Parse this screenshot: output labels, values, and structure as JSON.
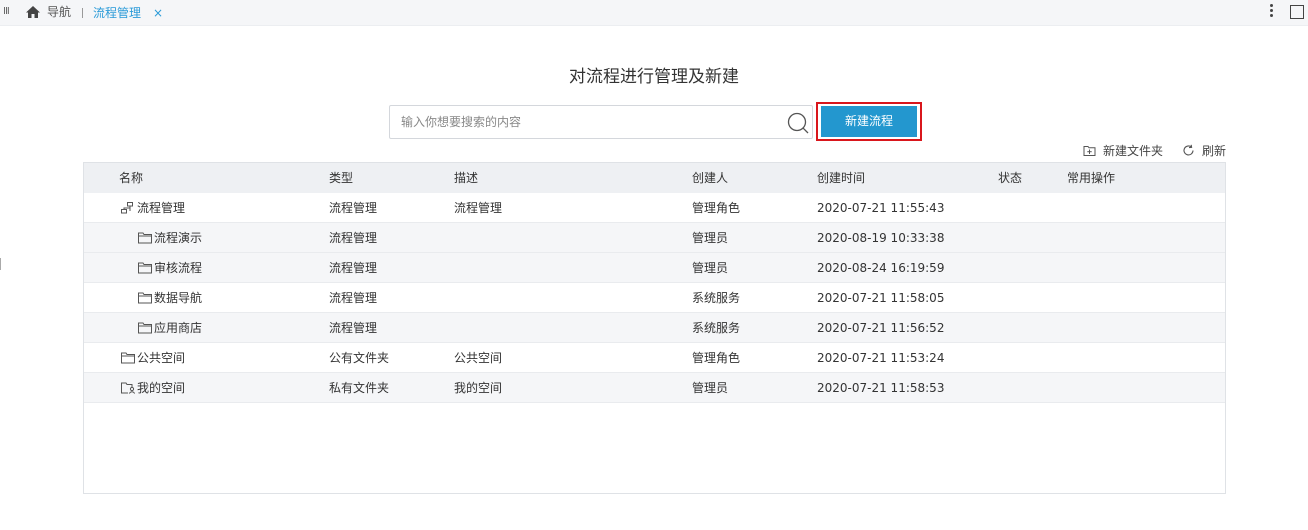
{
  "tabbar": {
    "grip_glyph": "III",
    "home_label": "导航",
    "active_tab_label": "流程管理",
    "close_glyph": "×"
  },
  "page": {
    "title": "对流程进行管理及新建"
  },
  "search": {
    "placeholder": "输入你想要搜索的内容",
    "value": ""
  },
  "actions": {
    "new_flow_label": "新建流程",
    "new_folder_label": "新建文件夹",
    "refresh_label": "刷新"
  },
  "table": {
    "columns": [
      "名称",
      "类型",
      "描述",
      "创建人",
      "创建时间",
      "状态",
      "常用操作"
    ],
    "rows": [
      {
        "icon": "flow-tree-icon",
        "name": "流程管理",
        "type": "流程管理",
        "desc": "流程管理",
        "creator": "管理角色",
        "created": "2020-07-21 11:55:43",
        "status": "",
        "ops": ""
      },
      {
        "icon": "folder-icon",
        "name": "流程演示",
        "type": "流程管理",
        "desc": "",
        "creator": "管理员",
        "created": "2020-08-19 10:33:38",
        "status": "",
        "ops": ""
      },
      {
        "icon": "folder-icon",
        "name": "审核流程",
        "type": "流程管理",
        "desc": "",
        "creator": "管理员",
        "created": "2020-08-24 16:19:59",
        "status": "",
        "ops": ""
      },
      {
        "icon": "folder-icon",
        "name": "数据导航",
        "type": "流程管理",
        "desc": "",
        "creator": "系统服务",
        "created": "2020-07-21 11:58:05",
        "status": "",
        "ops": ""
      },
      {
        "icon": "folder-icon",
        "name": "应用商店",
        "type": "流程管理",
        "desc": "",
        "creator": "系统服务",
        "created": "2020-07-21 11:56:52",
        "status": "",
        "ops": ""
      },
      {
        "icon": "folder-icon",
        "name": "公共空间",
        "type": "公有文件夹",
        "desc": "公共空间",
        "creator": "管理角色",
        "created": "2020-07-21 11:53:24",
        "status": "",
        "ops": ""
      },
      {
        "icon": "private-folder-icon",
        "name": "我的空间",
        "type": "私有文件夹",
        "desc": "我的空间",
        "creator": "管理员",
        "created": "2020-07-21 11:58:53",
        "status": "",
        "ops": ""
      }
    ]
  },
  "colors": {
    "accent": "#2397cf",
    "tab_active": "#2b9bd8",
    "highlight_border": "#d9161c",
    "header_bg": "#eef0f3",
    "alt_row_bg": "#f5f6f8"
  }
}
